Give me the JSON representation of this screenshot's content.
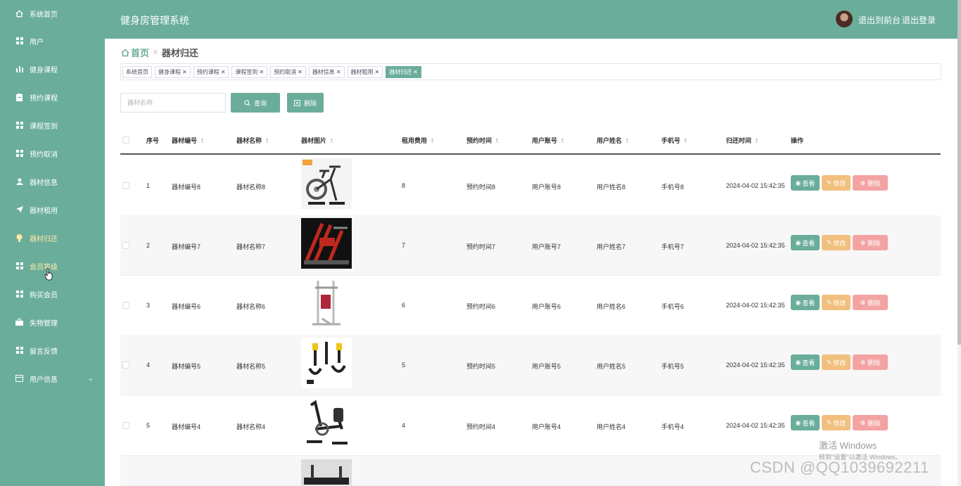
{
  "app": {
    "title": "健身房管理系统"
  },
  "header": {
    "front_link": "退出到前台",
    "logout_link": "退出登录"
  },
  "sidebar": {
    "items": [
      {
        "label": "系统首页",
        "icon": "home-icon"
      },
      {
        "label": "用户",
        "icon": "grid-icon"
      },
      {
        "label": "健身课程",
        "icon": "bar-chart-icon"
      },
      {
        "label": "预约课程",
        "icon": "clipboard-icon"
      },
      {
        "label": "课程签到",
        "icon": "grid-icon"
      },
      {
        "label": "预约取消",
        "icon": "grid-icon"
      },
      {
        "label": "器材信息",
        "icon": "user-icon"
      },
      {
        "label": "器材租用",
        "icon": "send-icon"
      },
      {
        "label": "器材归还",
        "icon": "bulb-icon"
      },
      {
        "label": "会员等级",
        "icon": "grid-icon"
      },
      {
        "label": "购买会员",
        "icon": "grid-icon"
      },
      {
        "label": "失物管理",
        "icon": "briefcase-icon"
      },
      {
        "label": "留言反馈",
        "icon": "grid-icon"
      },
      {
        "label": "用户信息",
        "icon": "id-card-icon"
      }
    ]
  },
  "breadcrumb": {
    "home": "首页",
    "current": "器材归还"
  },
  "tags": [
    "系统首页",
    "健身课程",
    "预约课程",
    "课程签到",
    "预约取消",
    "器材信息",
    "器材租用",
    "器材归还"
  ],
  "search": {
    "placeholder": "器材名称",
    "query_label": "查询",
    "delete_label": "删除"
  },
  "table": {
    "headers": {
      "index": "序号",
      "code": "器材编号",
      "name": "器材名称",
      "image": "器材图片",
      "fee": "租用费用",
      "reserve_time": "预约时间",
      "account": "用户账号",
      "user_name": "用户姓名",
      "phone": "手机号",
      "return_time": "归还时间",
      "ops": "操作"
    },
    "actions": {
      "view": "查看",
      "edit": "修改",
      "delete": "删除"
    },
    "rows": [
      {
        "index": "1",
        "code": "器材编号8",
        "name": "器材名称8",
        "fee": "8",
        "reserve_time": "预约时间8",
        "account": "用户账号8",
        "user_name": "用户姓名8",
        "phone": "手机号8",
        "return_time": "2024-04-02 15:42:35",
        "image": "exercise-bike"
      },
      {
        "index": "2",
        "code": "器材编号7",
        "name": "器材名称7",
        "fee": "7",
        "reserve_time": "预约时间7",
        "account": "用户账号7",
        "user_name": "用户姓名7",
        "phone": "手机号7",
        "return_time": "2024-04-02 15:42:35",
        "image": "leg-press"
      },
      {
        "index": "3",
        "code": "器材编号6",
        "name": "器材名称6",
        "fee": "6",
        "reserve_time": "预约时间6",
        "account": "用户账号6",
        "user_name": "用户姓名6",
        "phone": "手机号6",
        "return_time": "2024-04-02 15:42:35",
        "image": "power-tower"
      },
      {
        "index": "4",
        "code": "器材编号5",
        "name": "器材名称5",
        "fee": "5",
        "reserve_time": "预约时间5",
        "account": "用户账号5",
        "user_name": "用户姓名5",
        "phone": "手机号5",
        "return_time": "2024-04-02 15:42:35",
        "image": "suspension-straps"
      },
      {
        "index": "5",
        "code": "器材编号4",
        "name": "器材名称4",
        "fee": "4",
        "reserve_time": "预约时间4",
        "account": "用户账号4",
        "user_name": "用户姓名4",
        "phone": "手机号4",
        "return_time": "2024-04-02 15:42:35",
        "image": "recumbent-bike"
      }
    ]
  },
  "watermark": {
    "windows_title": "激活 Windows",
    "windows_sub": "转到\"设置\"以激活 Windows。",
    "csdn": "CSDN @QQ1039692211"
  },
  "colors": {
    "primary": "#6aad9b",
    "edit": "#f2c07e",
    "delete": "#f4a3a3",
    "active_menu": "#ffe9a6"
  }
}
